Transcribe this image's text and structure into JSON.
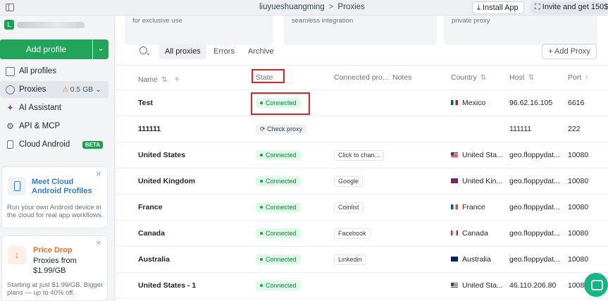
{
  "titlebar": {
    "crumbs": [
      "liuyueshuangming",
      "Proxies"
    ],
    "separator": ">",
    "install_label": "Install App",
    "invite_label": "Invite and get 150$"
  },
  "sidebar": {
    "account_initial": "L",
    "add_profile_label": "Add profile",
    "items": [
      {
        "label": "All profiles",
        "icon": "profiles-icon"
      },
      {
        "label": "Proxies",
        "icon": "globe-icon",
        "usage": "0.5 GB"
      },
      {
        "label": "AI Assistant",
        "icon": "sparkle-icon"
      },
      {
        "label": "API & MCP",
        "icon": "gear-icon"
      },
      {
        "label": "Cloud Android",
        "icon": "phone-icon",
        "badge": "BETA"
      }
    ],
    "promo_cloud": {
      "title": "Meet Cloud Android Profiles",
      "desc": "Run your own Android device in the cloud for real app workflows."
    },
    "promo_price": {
      "title": "Price Drop",
      "subtitle": "Proxies from $1.99/GB",
      "desc": "Starting at just $1.99/GB. Bigger plans — up to 40% off."
    }
  },
  "top_cards": [
    "for exclusive use",
    "seamless integration",
    "private proxy"
  ],
  "toolbar": {
    "tabs": [
      "All proxies",
      "Errors",
      "Archive"
    ],
    "add_proxy_label": "+ Add Proxy"
  },
  "table": {
    "headers": {
      "name": "Name",
      "state": "State",
      "connected": "Connected pro...",
      "notes": "Notes",
      "country": "Country",
      "host": "Host",
      "port": "Port"
    },
    "rows": [
      {
        "name": "Test",
        "state": "Connected",
        "note": "",
        "flag": "mx",
        "country": "Mexico",
        "host": "96.62.16.105",
        "port": "6616"
      },
      {
        "name": "111111",
        "state": "Check proxy",
        "note": "",
        "flag": "",
        "country": "",
        "host": "111111",
        "port": "222"
      },
      {
        "name": "United States",
        "state": "Connected",
        "note": "Click to chan...",
        "flag": "us",
        "country": "United Sta...",
        "host": "geo.floppydat...",
        "port": "10080"
      },
      {
        "name": "United Kingdom",
        "state": "Connected",
        "note": "Google",
        "flag": "gb",
        "country": "United Kin...",
        "host": "geo.floppydat...",
        "port": "10080"
      },
      {
        "name": "France",
        "state": "Connected",
        "note": "Coinlist",
        "flag": "fr",
        "country": "France",
        "host": "geo.floppydat...",
        "port": "10080"
      },
      {
        "name": "Canada",
        "state": "Connected",
        "note": "Facebook",
        "flag": "ca",
        "country": "Canada",
        "host": "geo.floppydat...",
        "port": "10080"
      },
      {
        "name": "Australia",
        "state": "Connected",
        "note": "Linkedin",
        "flag": "au",
        "country": "Australia",
        "host": "geo.floppydat...",
        "port": "10080"
      },
      {
        "name": "United States - 1",
        "state": "Connected",
        "note": "",
        "flag": "us",
        "country": "United Sta...",
        "host": "46.110.206.80",
        "port": "10080"
      }
    ]
  },
  "colors": {
    "accent": "#22a55b",
    "highlight": "#e02424",
    "connected_bg": "#dcfce7"
  }
}
